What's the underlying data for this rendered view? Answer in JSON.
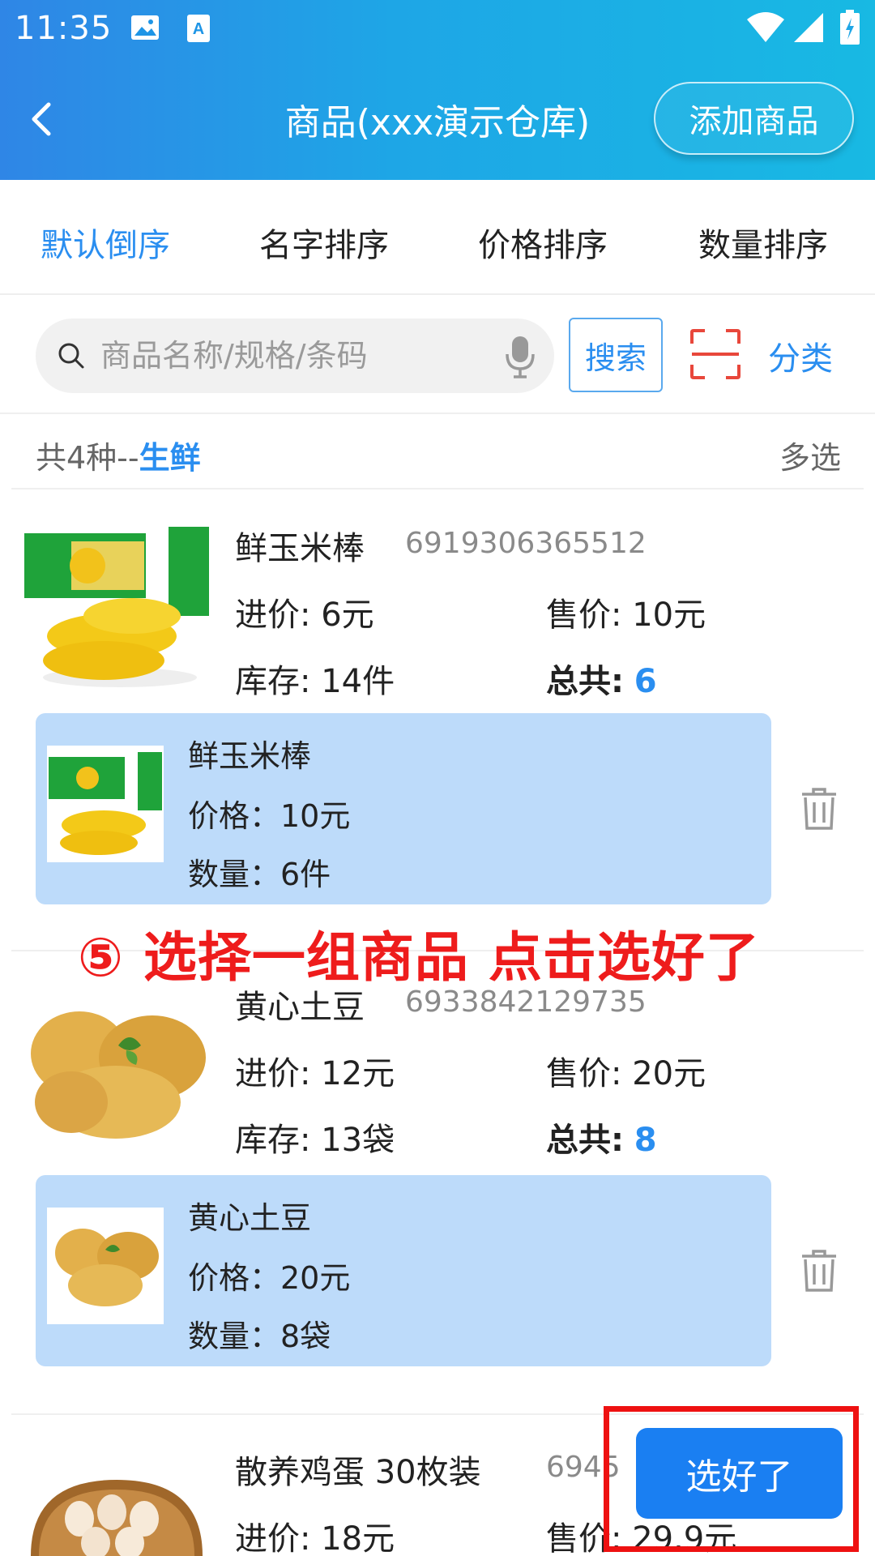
{
  "status_bar": {
    "time": "11:35",
    "icons": [
      "image-icon",
      "a-icon",
      "wifi-icon",
      "signal-icon",
      "battery-icon"
    ]
  },
  "header": {
    "back_icon": "chevron-left-icon",
    "title": "商品(xxx演示仓库)",
    "add_button": "添加商品"
  },
  "sort_tabs": [
    {
      "label": "默认倒序",
      "active": true
    },
    {
      "label": "名字排序",
      "active": false
    },
    {
      "label": "价格排序",
      "active": false
    },
    {
      "label": "数量排序",
      "active": false
    }
  ],
  "search": {
    "placeholder": "商品名称/规格/条码",
    "value": "",
    "search_button": "搜索",
    "category_button": "分类"
  },
  "summary": {
    "count_text": "共4种--",
    "category": "生鲜",
    "multi_select": "多选"
  },
  "products": [
    {
      "name": "鲜玉米棒",
      "code": "6919306365512",
      "purchase_price": "进价: 6元",
      "sale_price": "售价: 10元",
      "stock": "库存: 14件",
      "total_label": "总共:",
      "total_value": "6",
      "selected": {
        "name": "鲜玉米棒",
        "price": "价格：10元",
        "quantity": "数量：6件"
      }
    },
    {
      "name": "黄心土豆",
      "code": "6933842129735",
      "purchase_price": "进价: 12元",
      "sale_price": "售价: 20元",
      "stock": "库存: 13袋",
      "total_label": "总共:",
      "total_value": "8",
      "selected": {
        "name": "黄心土豆",
        "price": "价格：20元",
        "quantity": "数量：8袋"
      }
    },
    {
      "name": "散养鸡蛋   30枚装",
      "code": "6945",
      "purchase_price": "进价: 18元",
      "sale_price": "售价: 29.9元"
    }
  ],
  "annotation": "⑤ 选择一组商品 点击选好了",
  "done_button": "选好了",
  "colors": {
    "accent": "#2a8ef0",
    "selected_bg": "#bddbfa",
    "annotation": "#ee1c1c"
  }
}
